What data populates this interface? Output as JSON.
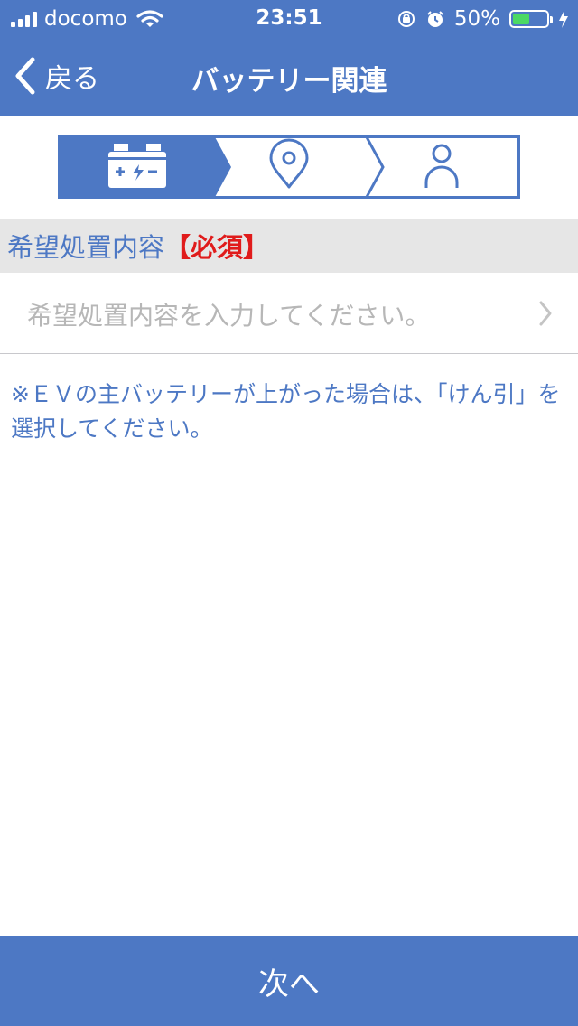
{
  "status_bar": {
    "carrier": "docomo",
    "time": "23:51",
    "battery_percent": "50%",
    "battery_level": 0.5,
    "icons": [
      "signal-icon",
      "wifi-icon",
      "orientation-lock-icon",
      "alarm-icon",
      "battery-icon",
      "charging-icon"
    ]
  },
  "nav": {
    "back_label": "戻る",
    "title": "バッテリー関連"
  },
  "steps": {
    "items": [
      {
        "icon": "battery-icon",
        "active": true
      },
      {
        "icon": "location-pin-icon",
        "active": false
      },
      {
        "icon": "person-icon",
        "active": false
      }
    ],
    "colors": {
      "active_bg": "#4d78c4",
      "inactive_bg": "#ffffff",
      "border": "#4d78c4"
    }
  },
  "section": {
    "title": "希望処置内容",
    "required_label": "【必須】"
  },
  "input": {
    "placeholder": "希望処置内容を入力してください。"
  },
  "note": {
    "text": "※ＥＶの主バッテリーが上がった場合は、「けん引」を選択してください。"
  },
  "footer": {
    "next_label": "次へ"
  },
  "colors": {
    "brand": "#4d78c4",
    "required": "#e01b1b",
    "placeholder": "#b7b7b7",
    "section_bg": "#e6e6e6"
  }
}
